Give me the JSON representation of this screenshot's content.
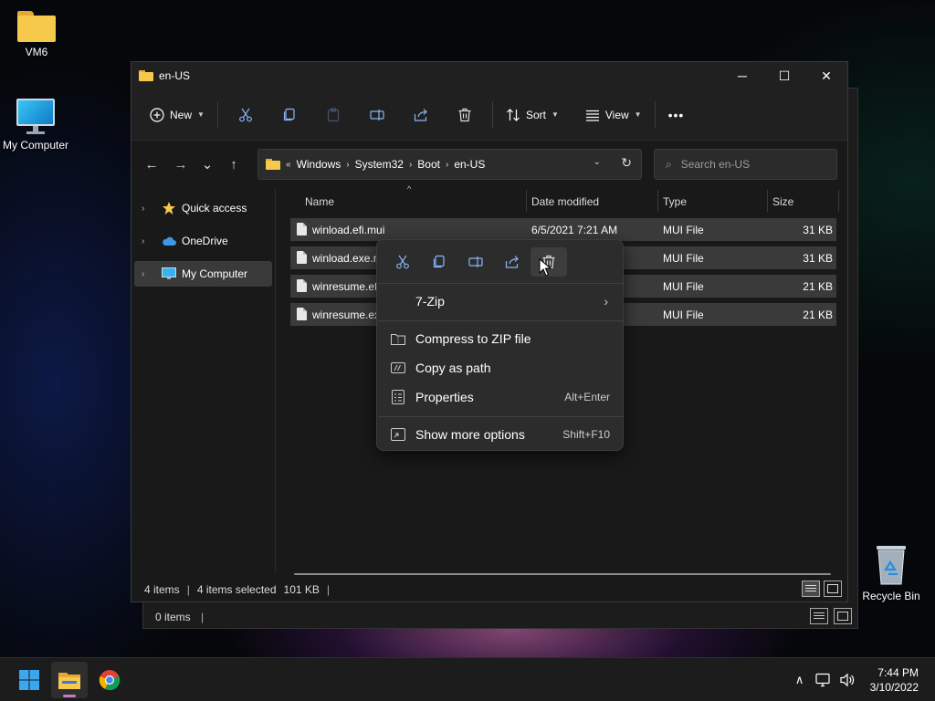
{
  "desktop": {
    "icons": [
      {
        "label": "VM6",
        "icon": "folder-icon"
      },
      {
        "label": "My Computer",
        "icon": "monitor-icon"
      },
      {
        "label": "Recycle Bin",
        "icon": "recycle-bin-icon"
      }
    ]
  },
  "window": {
    "title": "en-US",
    "controls": {
      "minimize": "─",
      "maximize": "☐",
      "close": "✕"
    }
  },
  "toolbar": {
    "new_label": "New",
    "sort_label": "Sort",
    "view_label": "View",
    "more_label": "•••",
    "icons": [
      "cut-icon",
      "copy-icon",
      "paste-icon",
      "rename-icon",
      "share-icon",
      "delete-icon"
    ]
  },
  "navigation": {
    "back": "←",
    "forward": "→",
    "recent": "⌄",
    "up": "↑"
  },
  "address": {
    "overflow": "«",
    "crumbs": [
      "Windows",
      "System32",
      "Boot",
      "en-US"
    ],
    "separator": "›",
    "refresh": "↻"
  },
  "search": {
    "placeholder": "Search en-US"
  },
  "sidebar": {
    "items": [
      {
        "label": "Quick access",
        "icon": "star-icon",
        "selected": false
      },
      {
        "label": "OneDrive",
        "icon": "cloud-icon",
        "selected": false
      },
      {
        "label": "My Computer",
        "icon": "monitor-icon",
        "selected": true
      }
    ]
  },
  "columns": {
    "name": "Name",
    "date": "Date modified",
    "type": "Type",
    "size": "Size",
    "sort_indicator": "^"
  },
  "files": [
    {
      "name": "winload.efi.mui",
      "date": "6/5/2021 7:21 AM",
      "type": "MUI File",
      "size": "31 KB"
    },
    {
      "name": "winload.exe.r",
      "date": "",
      "type": "MUI File",
      "size": "31 KB"
    },
    {
      "name": "winresume.ef",
      "date": "",
      "type": "MUI File",
      "size": "21 KB"
    },
    {
      "name": "winresume.ex",
      "date": "",
      "type": "MUI File",
      "size": "21 KB"
    }
  ],
  "status": {
    "count": "4 items",
    "sep": "|",
    "selected": "4 items selected",
    "size": "101 KB"
  },
  "back_window": {
    "status_count": "0 items",
    "sep": "|"
  },
  "context_menu": {
    "icons": [
      "cut-icon",
      "copy-icon",
      "rename-icon",
      "share-icon",
      "delete-icon"
    ],
    "items": {
      "zip7": {
        "label": "7-Zip",
        "arrow": "›"
      },
      "compress": {
        "label": "Compress to ZIP file"
      },
      "copy_path": {
        "label": "Copy as path"
      },
      "properties": {
        "label": "Properties",
        "shortcut": "Alt+Enter"
      },
      "more_options": {
        "label": "Show more options",
        "shortcut": "Shift+F10"
      }
    }
  },
  "taskbar": {
    "apps": [
      "windows-start-icon",
      "file-explorer-icon",
      "chrome-icon"
    ],
    "tray": {
      "chevron": "∧"
    },
    "time": "7:44 PM",
    "date": "3/10/2022"
  },
  "colors": {
    "accent_folder": "#f6c84c",
    "selection_row": "#3a3a3a",
    "menu_bg": "#2c2c2c",
    "taskbar_indicator": "#c77dba"
  }
}
